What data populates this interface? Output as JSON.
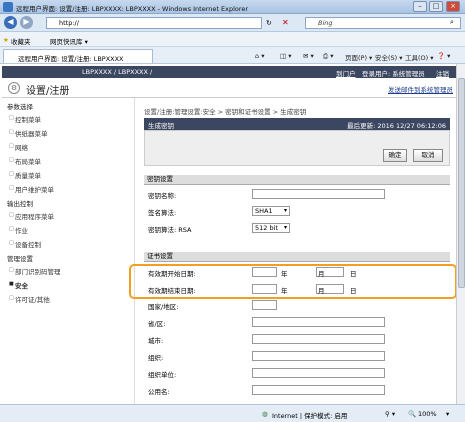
{
  "window": {
    "title": "远程用户界面: 设置/注册: LBPXXXX: LBPXXXX - Windows Internet Explorer"
  },
  "address": {
    "url": "http://",
    "search_placeholder": "Bing"
  },
  "favorites": {
    "label": "收藏夹",
    "item": "网页快讯库 ▾"
  },
  "tab": {
    "label": "远程用户界面: 设置/注册: LBPXXXX"
  },
  "commands": {
    "page": "页面(P) ▾",
    "safety": "安全(S) ▾",
    "tools": "工具(O) ▾",
    "help": "❓ ▾"
  },
  "page_header": {
    "product": "LBPXXXX / LBPXXXX /",
    "portal": "到门户",
    "login_user": "登录用户: 系统管理员",
    "logout": "注销"
  },
  "page_title": {
    "title": "设置/注册",
    "mail_link": "发送邮件到系统管理员"
  },
  "sidebar": {
    "section1": "参数选择",
    "s1_items": [
      "控制菜单",
      "供纸器菜单",
      "网络",
      "布局菜单",
      "质量菜单",
      "用户维护菜单"
    ],
    "section2": "输出控制",
    "s2_items": [
      "应用程序菜单",
      "作业",
      "设备控制"
    ],
    "section3": "管理设置",
    "s3_items": [
      "部门识别码管理",
      "安全",
      "许可证/其他"
    ]
  },
  "breadcrumb": "设置/注册:管理设置:安全 > 密钥和证书设置 > 生成密钥",
  "card": {
    "title": "生成密钥",
    "updated": "最后更新: 2016 12/27 06:12:06"
  },
  "buttons": {
    "ok": "确定",
    "cancel": "取消"
  },
  "key_section": {
    "title": "密钥设置",
    "key_name": "密钥名称:",
    "sig_algo": "签名算法:",
    "sig_algo_value": "SHA1",
    "key_algo": "密钥算法: RSA",
    "key_algo_value": "512 bit"
  },
  "cert_section": {
    "title": "证书设置",
    "start_date": "有效期开始日期:",
    "end_date": "有效期结束日期:",
    "year": "年",
    "month": "月",
    "day": "日",
    "country": "国家/地区:",
    "state": "省/区:",
    "city": "城市:",
    "org": "组织:",
    "org_unit": "组织单位:",
    "common_name": "公用名:"
  },
  "statusbar": {
    "zone": "Internet | 保护模式: 启用",
    "zoom": "100%"
  }
}
